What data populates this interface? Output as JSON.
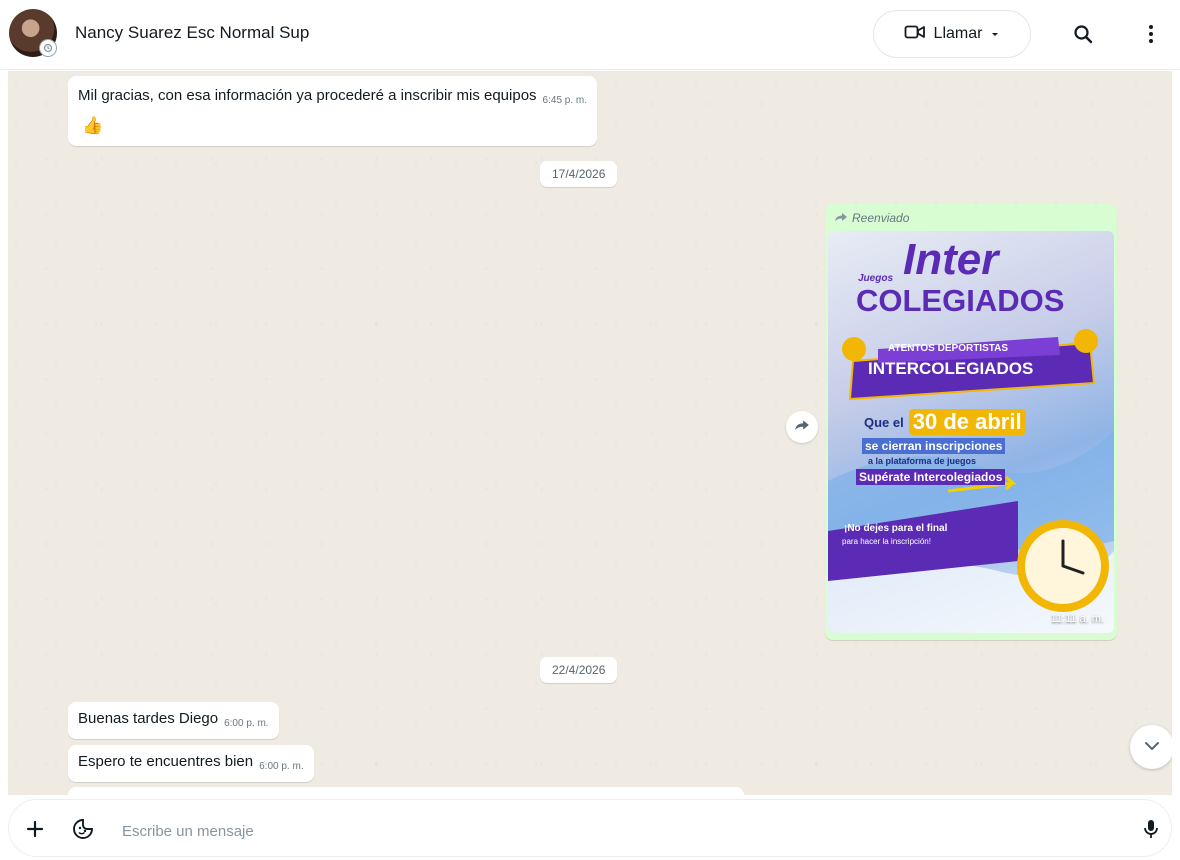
{
  "header": {
    "contact_name": "Nancy Suarez Esc Normal Sup",
    "call_label": "Llamar"
  },
  "messages": {
    "m1_text": "Mil gracias, con esa información ya procederé a inscribir mis equipos",
    "m1_time": "6:45 p. m.",
    "reaction": "👍",
    "date1": "17/4/2026",
    "forwarded_label": "Reenviado",
    "image_time": "11:11 a. m.",
    "date2": "22/4/2026",
    "m2_text": "Buenas tardes Diego",
    "m2_time": "6:00 p. m.",
    "m3_text": "Espero te encuentres bien",
    "m3_time": "6:00 p. m."
  },
  "poster": {
    "juegos": "Juegos",
    "inter": "Inter",
    "colegiados": "COLEGIADOS",
    "banner1": "ATENTOS DEPORTISTAS",
    "banner2": "INTERCOLEGIADOS",
    "line1_a": "Que el",
    "line1_b": "30 de abril",
    "line2": "se cierran inscripciones",
    "line3": "a la plataforma de juegos",
    "line4": "Supérate Intercolegiados",
    "cta1": "¡No dejes para el final",
    "cta2": "para hacer la inscripción!"
  },
  "composer": {
    "placeholder": "Escribe un mensaje"
  },
  "colors": {
    "chat_bg": "#efeae2",
    "outgoing_bubble": "#d9fdd3",
    "poster_purple": "#5b2bb5",
    "poster_gold": "#f2b705"
  },
  "icons": [
    "video-call-icon",
    "chevron-down-icon",
    "search-icon",
    "menu-dots-icon",
    "forward-icon",
    "plus-icon",
    "sticker-icon",
    "mic-icon",
    "status-ring-icon"
  ]
}
